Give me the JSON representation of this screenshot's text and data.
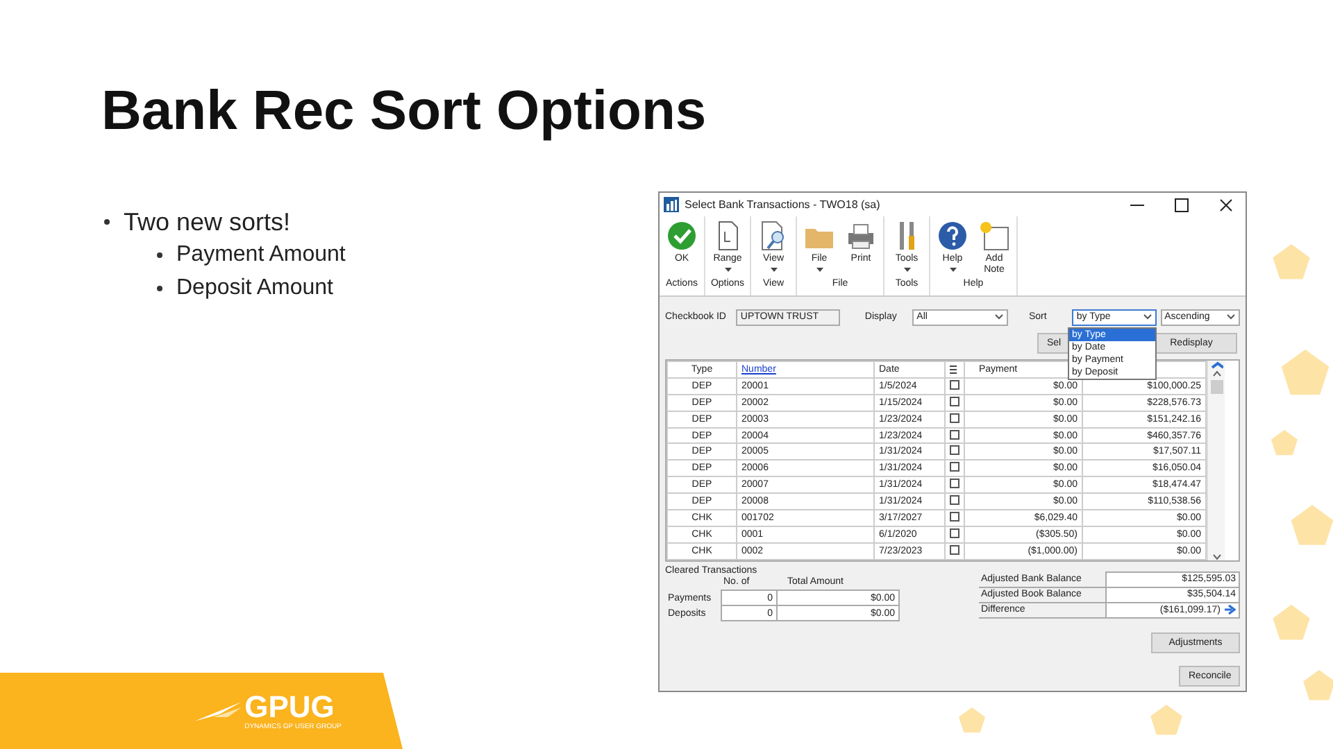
{
  "slide": {
    "title": "Bank Rec Sort Options",
    "bullets": [
      {
        "text": "Two new sorts!",
        "children": [
          {
            "text": "Payment Amount"
          },
          {
            "text": "Deposit Amount"
          }
        ]
      }
    ],
    "logo": {
      "name": "GPUG",
      "tagline": "DYNAMICS GP USER GROUP"
    }
  },
  "window": {
    "title": "Select Bank Transactions  -  TWO18 (sa)",
    "ribbon": [
      {
        "label": "Actions",
        "buttons": [
          {
            "kind": "ok",
            "label": "OK",
            "dropdown": false
          }
        ]
      },
      {
        "label": "Options",
        "buttons": [
          {
            "kind": "range",
            "label": "Range",
            "dropdown": true
          }
        ]
      },
      {
        "label": "View",
        "buttons": [
          {
            "kind": "view",
            "label": "View",
            "dropdown": true
          }
        ]
      },
      {
        "label": "File",
        "buttons": [
          {
            "kind": "file",
            "label": "File",
            "dropdown": true
          },
          {
            "kind": "print",
            "label": "Print",
            "dropdown": false
          }
        ]
      },
      {
        "label": "Tools",
        "buttons": [
          {
            "kind": "tools",
            "label": "Tools",
            "dropdown": true
          }
        ]
      },
      {
        "label": "Help",
        "buttons": [
          {
            "kind": "help",
            "label": "Help",
            "dropdown": true
          },
          {
            "kind": "note",
            "label": "Add Note",
            "dropdown": false
          }
        ]
      }
    ],
    "checkbook": {
      "label": "Checkbook ID",
      "value": "UPTOWN TRUST"
    },
    "display": {
      "label": "Display",
      "value": "All"
    },
    "sort": {
      "label": "Sort",
      "value": "by Type",
      "order": "Ascending",
      "expanded": true,
      "options": [
        {
          "label": "by Type",
          "selected": true
        },
        {
          "label": "by Date",
          "selected": false
        },
        {
          "label": "by Payment",
          "selected": false
        },
        {
          "label": "by Deposit",
          "selected": false
        }
      ]
    },
    "buttons": [
      "Sel",
      "Redisplay"
    ],
    "columns": [
      {
        "kind": "text",
        "label": "Type"
      },
      {
        "kind": "link",
        "label": "Number"
      },
      {
        "kind": "text",
        "label": "Date"
      },
      {
        "kind": "icon"
      },
      {
        "kind": "text",
        "label": "Payment"
      },
      {
        "kind": "blank"
      }
    ],
    "rows": [
      {
        "type": "DEP",
        "number": "20001",
        "date": "1/5/2024",
        "checked": false,
        "payment": "$0.00",
        "deposit": "$100,000.25"
      },
      {
        "type": "DEP",
        "number": "20002",
        "date": "1/15/2024",
        "checked": false,
        "payment": "$0.00",
        "deposit": "$228,576.73"
      },
      {
        "type": "DEP",
        "number": "20003",
        "date": "1/23/2024",
        "checked": false,
        "payment": "$0.00",
        "deposit": "$151,242.16"
      },
      {
        "type": "DEP",
        "number": "20004",
        "date": "1/23/2024",
        "checked": false,
        "payment": "$0.00",
        "deposit": "$460,357.76"
      },
      {
        "type": "DEP",
        "number": "20005",
        "date": "1/31/2024",
        "checked": false,
        "payment": "$0.00",
        "deposit": "$17,507.11"
      },
      {
        "type": "DEP",
        "number": "20006",
        "date": "1/31/2024",
        "checked": false,
        "payment": "$0.00",
        "deposit": "$16,050.04"
      },
      {
        "type": "DEP",
        "number": "20007",
        "date": "1/31/2024",
        "checked": false,
        "payment": "$0.00",
        "deposit": "$18,474.47"
      },
      {
        "type": "DEP",
        "number": "20008",
        "date": "1/31/2024",
        "checked": false,
        "payment": "$0.00",
        "deposit": "$110,538.56"
      },
      {
        "type": "CHK",
        "number": "001702",
        "date": "3/17/2027",
        "checked": false,
        "payment": "$6,029.40",
        "deposit": "$0.00"
      },
      {
        "type": "CHK",
        "number": "0001",
        "date": "6/1/2020",
        "checked": false,
        "payment": "($305.50)",
        "deposit": "$0.00"
      },
      {
        "type": "CHK",
        "number": "0002",
        "date": "7/23/2023",
        "checked": false,
        "payment": "($1,000.00)",
        "deposit": "$0.00"
      }
    ],
    "cleared": {
      "title": "Cleared Transactions",
      "headers": [
        "No. of",
        "Total Amount"
      ],
      "rows": [
        {
          "label": "Payments",
          "count": "0",
          "amount": "$0.00"
        },
        {
          "label": "Deposits",
          "count": "0",
          "amount": "$0.00"
        }
      ]
    },
    "balances": [
      {
        "label": "Adjusted Bank Balance",
        "value": "$125,595.03",
        "arrow": false
      },
      {
        "label": "Adjusted Book Balance",
        "value": "$35,504.14",
        "arrow": false
      },
      {
        "label": "Difference",
        "value": "($161,099.17)",
        "arrow": true
      }
    ],
    "actions": [
      "Adjustments",
      "Reconcile"
    ]
  }
}
